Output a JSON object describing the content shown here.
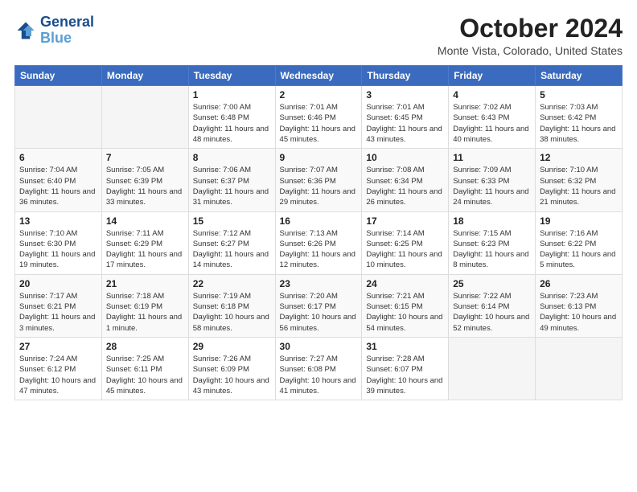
{
  "header": {
    "logo_line1": "General",
    "logo_line2": "Blue",
    "title": "October 2024",
    "subtitle": "Monte Vista, Colorado, United States"
  },
  "calendar": {
    "days_of_week": [
      "Sunday",
      "Monday",
      "Tuesday",
      "Wednesday",
      "Thursday",
      "Friday",
      "Saturday"
    ],
    "weeks": [
      [
        {
          "day": "",
          "info": ""
        },
        {
          "day": "",
          "info": ""
        },
        {
          "day": "1",
          "info": "Sunrise: 7:00 AM\nSunset: 6:48 PM\nDaylight: 11 hours and 48 minutes."
        },
        {
          "day": "2",
          "info": "Sunrise: 7:01 AM\nSunset: 6:46 PM\nDaylight: 11 hours and 45 minutes."
        },
        {
          "day": "3",
          "info": "Sunrise: 7:01 AM\nSunset: 6:45 PM\nDaylight: 11 hours and 43 minutes."
        },
        {
          "day": "4",
          "info": "Sunrise: 7:02 AM\nSunset: 6:43 PM\nDaylight: 11 hours and 40 minutes."
        },
        {
          "day": "5",
          "info": "Sunrise: 7:03 AM\nSunset: 6:42 PM\nDaylight: 11 hours and 38 minutes."
        }
      ],
      [
        {
          "day": "6",
          "info": "Sunrise: 7:04 AM\nSunset: 6:40 PM\nDaylight: 11 hours and 36 minutes."
        },
        {
          "day": "7",
          "info": "Sunrise: 7:05 AM\nSunset: 6:39 PM\nDaylight: 11 hours and 33 minutes."
        },
        {
          "day": "8",
          "info": "Sunrise: 7:06 AM\nSunset: 6:37 PM\nDaylight: 11 hours and 31 minutes."
        },
        {
          "day": "9",
          "info": "Sunrise: 7:07 AM\nSunset: 6:36 PM\nDaylight: 11 hours and 29 minutes."
        },
        {
          "day": "10",
          "info": "Sunrise: 7:08 AM\nSunset: 6:34 PM\nDaylight: 11 hours and 26 minutes."
        },
        {
          "day": "11",
          "info": "Sunrise: 7:09 AM\nSunset: 6:33 PM\nDaylight: 11 hours and 24 minutes."
        },
        {
          "day": "12",
          "info": "Sunrise: 7:10 AM\nSunset: 6:32 PM\nDaylight: 11 hours and 21 minutes."
        }
      ],
      [
        {
          "day": "13",
          "info": "Sunrise: 7:10 AM\nSunset: 6:30 PM\nDaylight: 11 hours and 19 minutes."
        },
        {
          "day": "14",
          "info": "Sunrise: 7:11 AM\nSunset: 6:29 PM\nDaylight: 11 hours and 17 minutes."
        },
        {
          "day": "15",
          "info": "Sunrise: 7:12 AM\nSunset: 6:27 PM\nDaylight: 11 hours and 14 minutes."
        },
        {
          "day": "16",
          "info": "Sunrise: 7:13 AM\nSunset: 6:26 PM\nDaylight: 11 hours and 12 minutes."
        },
        {
          "day": "17",
          "info": "Sunrise: 7:14 AM\nSunset: 6:25 PM\nDaylight: 11 hours and 10 minutes."
        },
        {
          "day": "18",
          "info": "Sunrise: 7:15 AM\nSunset: 6:23 PM\nDaylight: 11 hours and 8 minutes."
        },
        {
          "day": "19",
          "info": "Sunrise: 7:16 AM\nSunset: 6:22 PM\nDaylight: 11 hours and 5 minutes."
        }
      ],
      [
        {
          "day": "20",
          "info": "Sunrise: 7:17 AM\nSunset: 6:21 PM\nDaylight: 11 hours and 3 minutes."
        },
        {
          "day": "21",
          "info": "Sunrise: 7:18 AM\nSunset: 6:19 PM\nDaylight: 11 hours and 1 minute."
        },
        {
          "day": "22",
          "info": "Sunrise: 7:19 AM\nSunset: 6:18 PM\nDaylight: 10 hours and 58 minutes."
        },
        {
          "day": "23",
          "info": "Sunrise: 7:20 AM\nSunset: 6:17 PM\nDaylight: 10 hours and 56 minutes."
        },
        {
          "day": "24",
          "info": "Sunrise: 7:21 AM\nSunset: 6:15 PM\nDaylight: 10 hours and 54 minutes."
        },
        {
          "day": "25",
          "info": "Sunrise: 7:22 AM\nSunset: 6:14 PM\nDaylight: 10 hours and 52 minutes."
        },
        {
          "day": "26",
          "info": "Sunrise: 7:23 AM\nSunset: 6:13 PM\nDaylight: 10 hours and 49 minutes."
        }
      ],
      [
        {
          "day": "27",
          "info": "Sunrise: 7:24 AM\nSunset: 6:12 PM\nDaylight: 10 hours and 47 minutes."
        },
        {
          "day": "28",
          "info": "Sunrise: 7:25 AM\nSunset: 6:11 PM\nDaylight: 10 hours and 45 minutes."
        },
        {
          "day": "29",
          "info": "Sunrise: 7:26 AM\nSunset: 6:09 PM\nDaylight: 10 hours and 43 minutes."
        },
        {
          "day": "30",
          "info": "Sunrise: 7:27 AM\nSunset: 6:08 PM\nDaylight: 10 hours and 41 minutes."
        },
        {
          "day": "31",
          "info": "Sunrise: 7:28 AM\nSunset: 6:07 PM\nDaylight: 10 hours and 39 minutes."
        },
        {
          "day": "",
          "info": ""
        },
        {
          "day": "",
          "info": ""
        }
      ]
    ]
  }
}
